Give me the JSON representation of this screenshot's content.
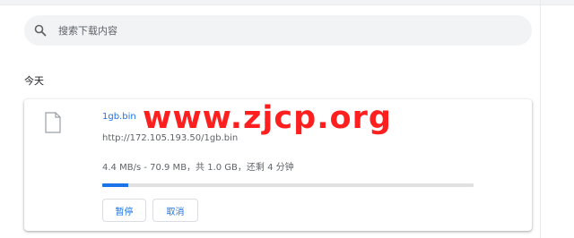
{
  "search": {
    "placeholder": "搜索下载内容"
  },
  "section": {
    "title": "今天"
  },
  "download": {
    "file_name": "1gb.bin",
    "url": "http://172.105.193.50/1gb.bin",
    "status": "4.4 MB/s - 70.9 MB，共 1.0 GB，还剩 4 分钟",
    "progress_fraction": 0.0692,
    "buttons": {
      "pause": "暂停",
      "cancel": "取消"
    }
  },
  "watermark": {
    "text": "www.zjcp.org"
  },
  "colors": {
    "accent": "#1a73e8",
    "watermark": "#ff1f1f",
    "search_bg": "#f1f3f4"
  },
  "icons": {
    "search": "search-icon",
    "file": "file-icon"
  }
}
